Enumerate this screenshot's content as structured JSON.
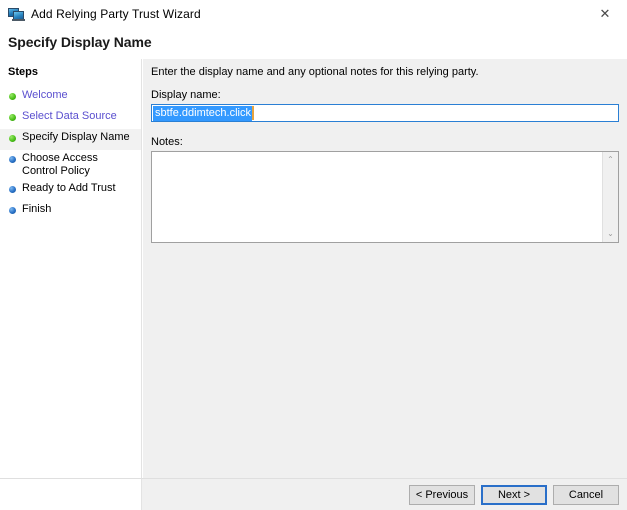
{
  "window": {
    "title": "Add Relying Party Trust Wizard",
    "app_icon": "wizard-app-icon",
    "close_icon": "✕"
  },
  "page": {
    "heading": "Specify Display Name",
    "intro": "Enter the display name and any optional notes for this relying party."
  },
  "sidebar": {
    "title": "Steps",
    "items": [
      {
        "label": "Welcome",
        "state": "done",
        "style": "link"
      },
      {
        "label": "Select Data Source",
        "state": "done",
        "style": "link"
      },
      {
        "label": "Specify Display Name",
        "state": "done",
        "style": "current"
      },
      {
        "label": "Choose Access Control Policy",
        "state": "pending",
        "style": "plain"
      },
      {
        "label": "Ready to Add Trust",
        "state": "pending",
        "style": "plain"
      },
      {
        "label": "Finish",
        "state": "pending",
        "style": "plain"
      }
    ]
  },
  "form": {
    "display_name_label": "Display name:",
    "display_name_value": "sbtfe.ddimtech.click",
    "display_name_selected": true,
    "notes_label": "Notes:",
    "notes_value": "",
    "notes_placeholder": ""
  },
  "scrollbar": {
    "up_arrow": "⌃",
    "down_arrow": "⌄"
  },
  "footer": {
    "previous_label": "< Previous",
    "next_label": "Next >",
    "cancel_label": "Cancel",
    "default_button": "Next >"
  },
  "colors": {
    "content_background": "#f0f0f0",
    "sidebar_background": "#ffffff",
    "link_text": "#5a4fcf",
    "selection": "#3399ff",
    "focus_border": "#2a6fc9",
    "step_done": "#4cc21a",
    "step_pending": "#2a72c8",
    "caret": "#e8a33d"
  }
}
